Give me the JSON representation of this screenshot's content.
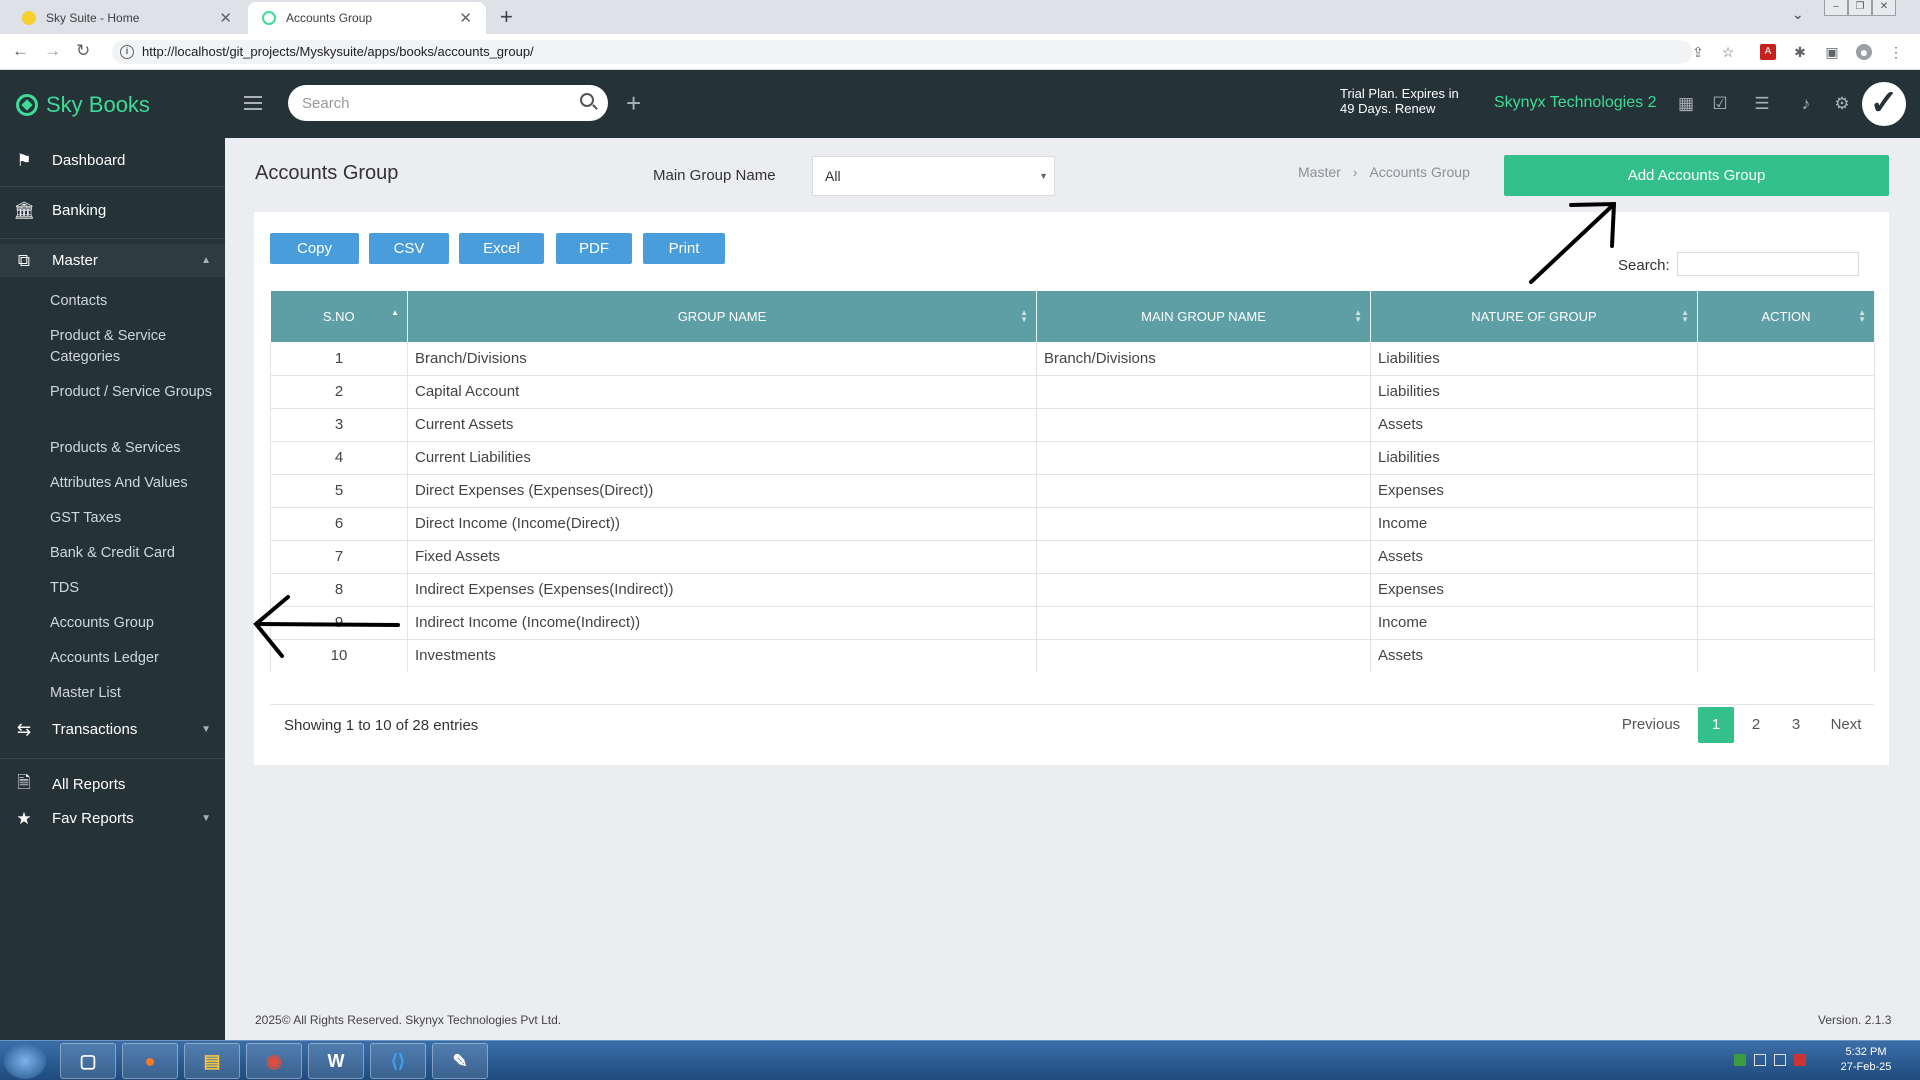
{
  "browser": {
    "tabs": [
      {
        "title": "Sky Suite - Home",
        "active": false
      },
      {
        "title": "Accounts Group",
        "active": true
      }
    ],
    "url": "http://localhost/git_projects/Myskysuite/apps/books/accounts_group/"
  },
  "header": {
    "brand": "Sky Books",
    "search_placeholder": "Search",
    "trial_text": "Trial Plan. Expires in 49 Days. Renew",
    "company": "Skynyx Technologies 2"
  },
  "sidebar": {
    "items": [
      {
        "label": "Dashboard",
        "icon": "flag-icon"
      },
      {
        "label": "Banking",
        "icon": "bank-icon"
      },
      {
        "label": "Master",
        "icon": "master-icon"
      },
      {
        "label": "Transactions",
        "icon": "transactions-icon"
      },
      {
        "label": "All Reports",
        "icon": "report-icon"
      },
      {
        "label": "Fav Reports",
        "icon": "star-icon"
      }
    ],
    "master_sub": [
      "Contacts",
      "Product & Service Categories",
      "Product / Service Groups",
      "Products & Services",
      "Attributes And Values",
      "GST Taxes",
      "Bank & Credit Card",
      "TDS",
      "Accounts Group",
      "Accounts Ledger",
      "Master List"
    ]
  },
  "main": {
    "title": "Accounts Group",
    "filter_label": "Main Group Name",
    "filter_value": "All",
    "breadcrumb": [
      "Master",
      "Accounts Group"
    ],
    "add_button": "Add Accounts Group",
    "export_buttons": [
      "Copy",
      "CSV",
      "Excel",
      "PDF",
      "Print"
    ],
    "search_label": "Search:",
    "columns": [
      "S.NO",
      "GROUP NAME",
      "MAIN GROUP NAME",
      "NATURE OF GROUP",
      "ACTION"
    ],
    "rows": [
      [
        "1",
        "Branch/Divisions",
        "Branch/Divisions",
        "Liabilities",
        ""
      ],
      [
        "2",
        "Capital Account",
        "",
        "Liabilities",
        ""
      ],
      [
        "3",
        "Current Assets",
        "",
        "Assets",
        ""
      ],
      [
        "4",
        "Current Liabilities",
        "",
        "Liabilities",
        ""
      ],
      [
        "5",
        "Direct Expenses (Expenses(Direct))",
        "",
        "Expenses",
        ""
      ],
      [
        "6",
        "Direct Income (Income(Direct))",
        "",
        "Income",
        ""
      ],
      [
        "7",
        "Fixed Assets",
        "",
        "Assets",
        ""
      ],
      [
        "8",
        "Indirect Expenses (Expenses(Indirect))",
        "",
        "Expenses",
        ""
      ],
      [
        "9",
        "Indirect Income (Income(Indirect))",
        "",
        "Income",
        ""
      ],
      [
        "10",
        "Investments",
        "",
        "Assets",
        ""
      ]
    ],
    "entries_text": "Showing 1 to 10 of 28 entries",
    "pagination": {
      "previous": "Previous",
      "pages": [
        "1",
        "2",
        "3"
      ],
      "next": "Next",
      "current": "1"
    }
  },
  "footer": {
    "copyright": "2025© All Rights Reserved. Skynyx Technologies Pvt Ltd.",
    "version": "Version. 2.1.3"
  },
  "taskbar": {
    "time": "5:32 PM",
    "date": "27-Feb-25"
  },
  "colors": {
    "brand_green": "#3ddc97",
    "header_bg": "#253237",
    "table_header": "#5e9fa6",
    "export_blue": "#4a9ddb",
    "add_green": "#34c08a"
  }
}
